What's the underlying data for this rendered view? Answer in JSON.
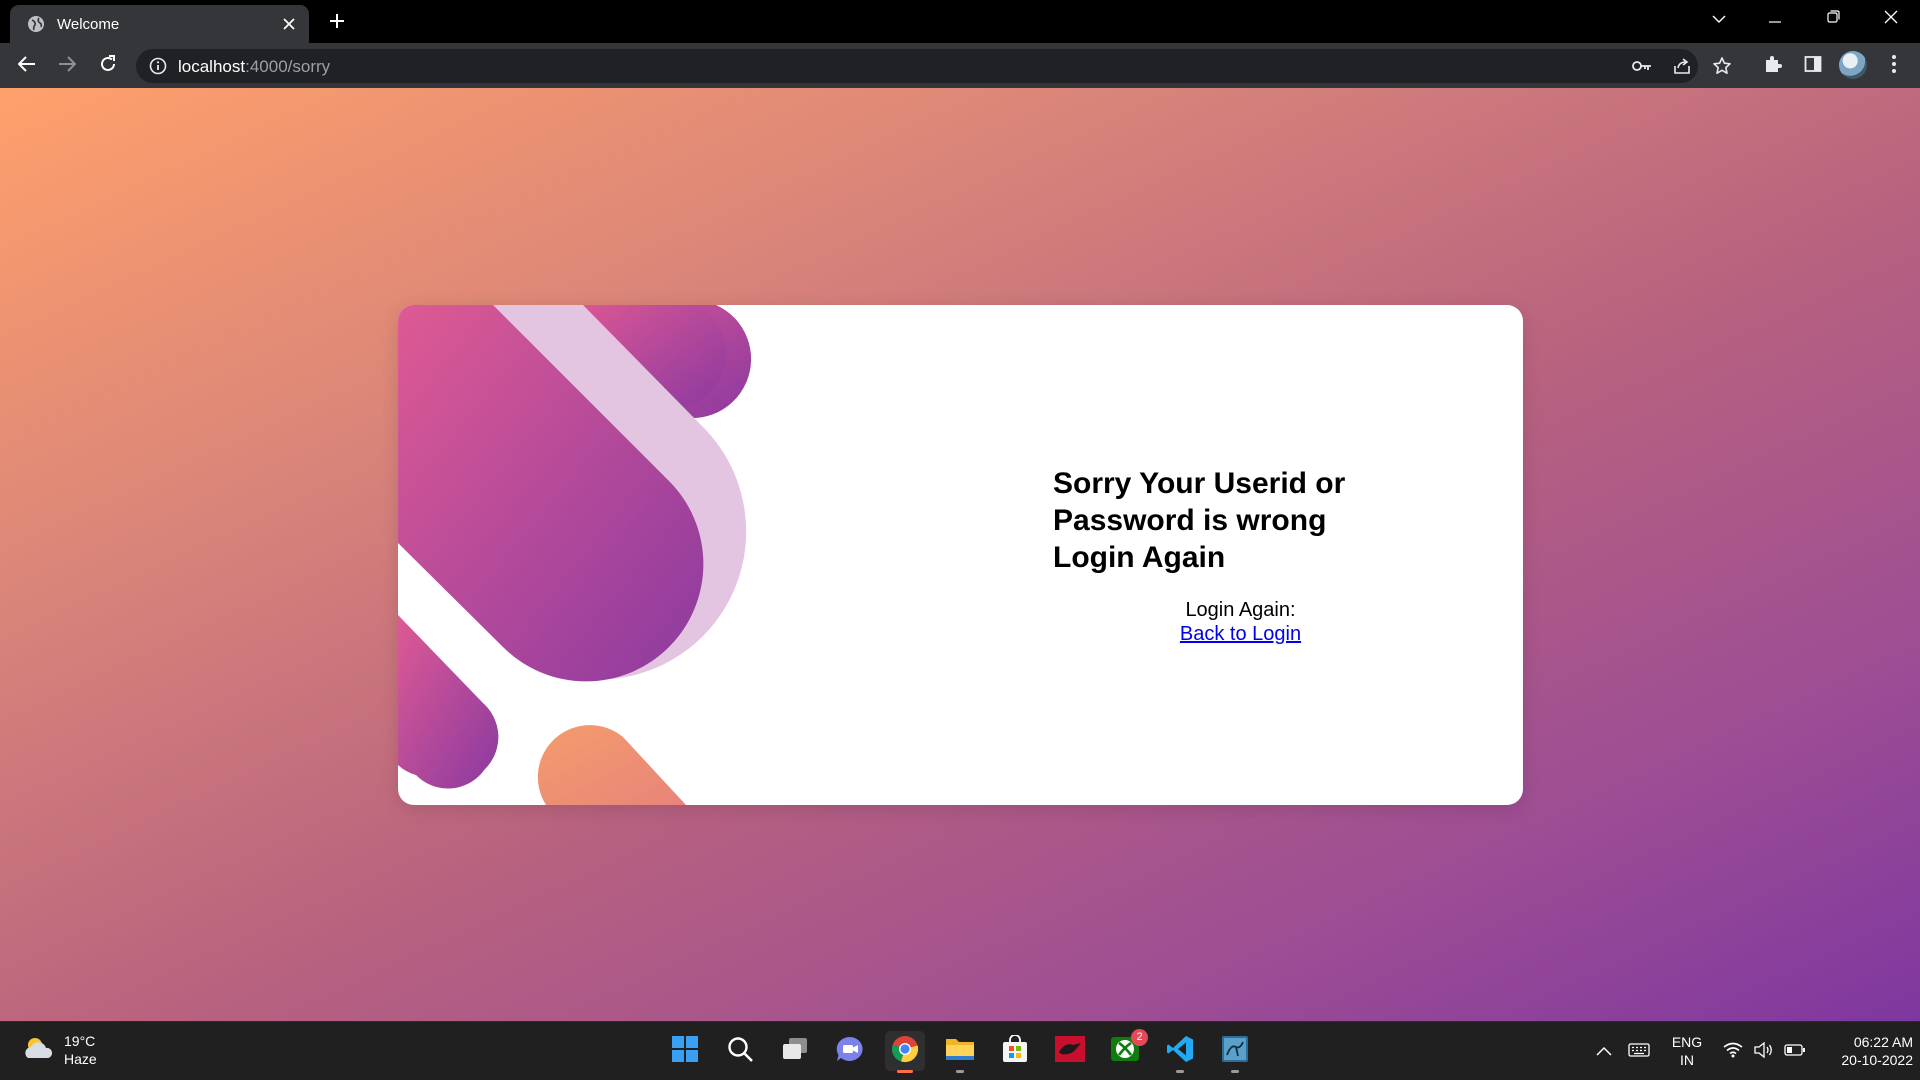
{
  "browser": {
    "tab_title": "Welcome",
    "url_host": "localhost",
    "url_path": ":4000/sorry"
  },
  "page": {
    "heading": "Sorry Your Userid or Password is wrong Login Again",
    "login_again_label": "Login Again:",
    "back_link": "Back to Login"
  },
  "taskbar": {
    "weather_temp": "19°C",
    "weather_desc": "Haze",
    "xbox_badge": "2",
    "lang_top": "ENG",
    "lang_bottom": "IN",
    "time": "06:22 AM",
    "date": "20-10-2022"
  },
  "colors": {
    "gradient_start": "#ffa06b",
    "gradient_end": "#7e379f",
    "link": "#0000ee"
  },
  "icons": {
    "tab": [
      "globe-icon",
      "close-icon",
      "plus-icon"
    ],
    "window": [
      "chevron-down-icon",
      "minimize-icon",
      "restore-icon",
      "close-icon"
    ],
    "toolbar": [
      "back-arrow-icon",
      "forward-arrow-icon",
      "reload-icon",
      "info-icon",
      "key-icon",
      "share-icon",
      "star-icon",
      "puzzle-icon",
      "sidepanel-icon",
      "kebab-menu-icon"
    ],
    "taskbar": [
      "start-icon",
      "search-icon",
      "task-view-icon",
      "chat-icon",
      "chrome-icon",
      "file-explorer-icon",
      "store-icon",
      "app-red-icon",
      "xbox-icon",
      "vscode-icon",
      "mysql-icon"
    ]
  }
}
